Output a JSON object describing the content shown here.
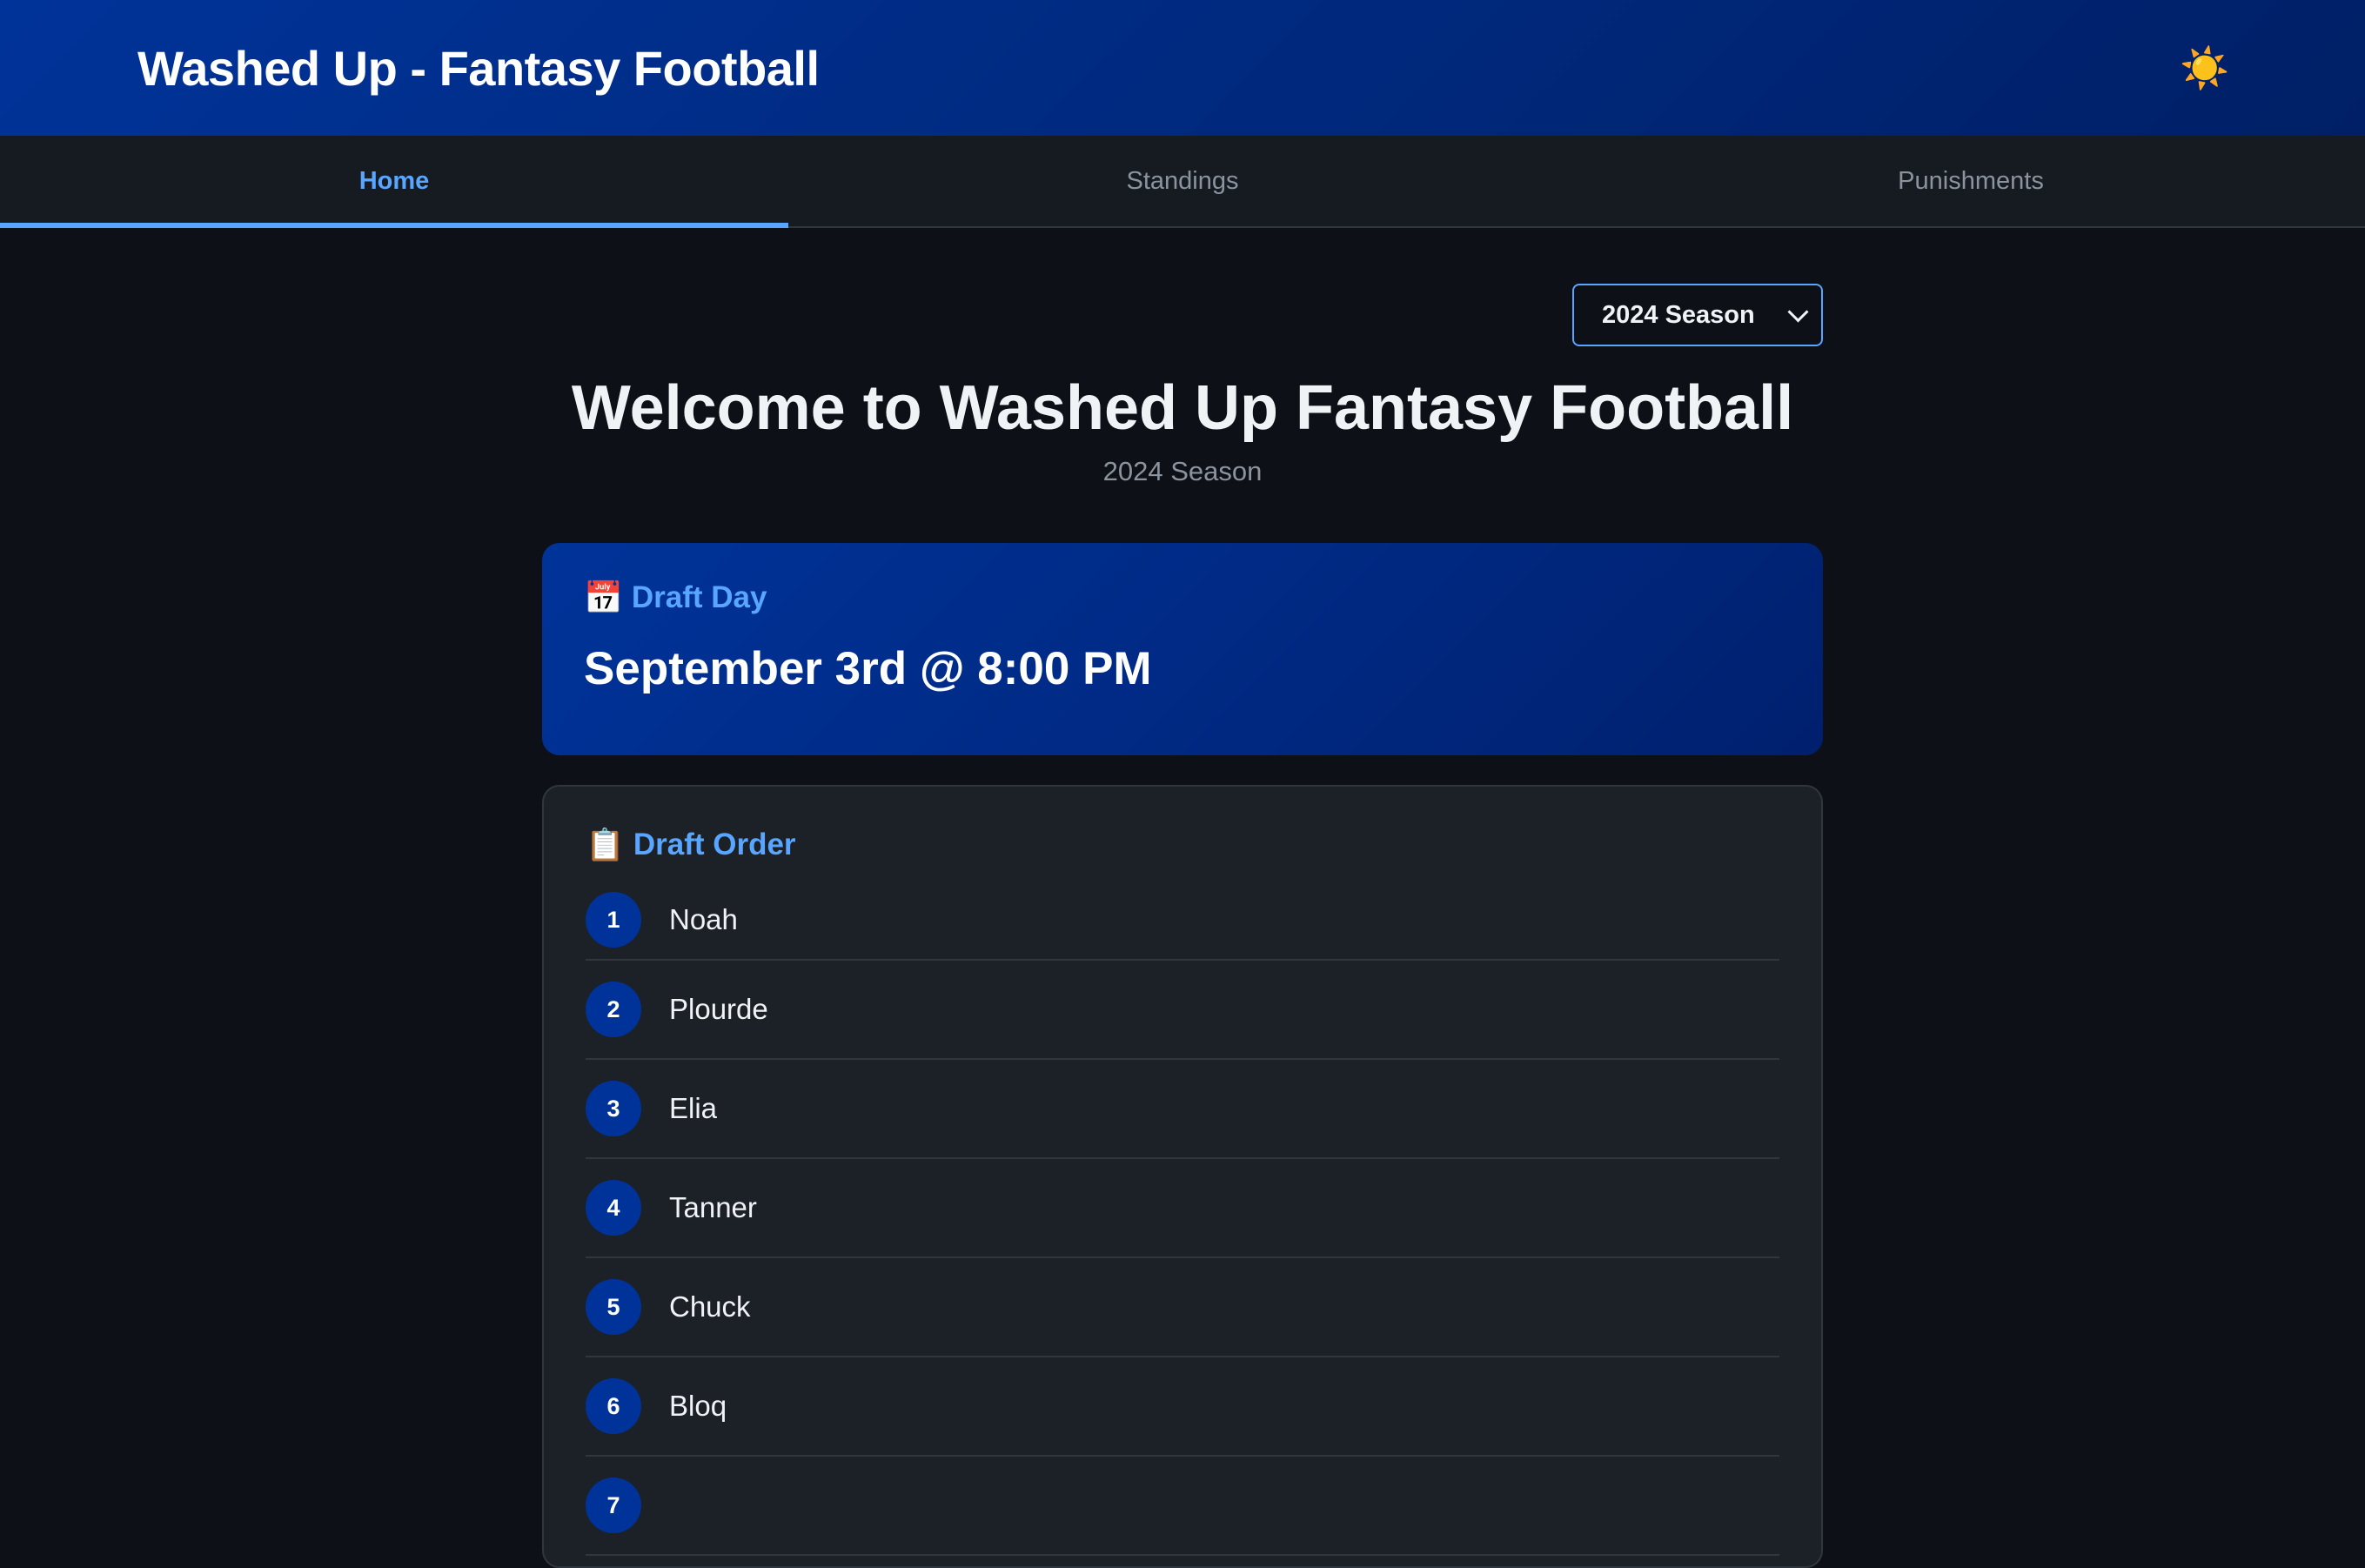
{
  "header": {
    "title": "Washed Up - Fantasy Football",
    "theme_icon": "sun-icon",
    "theme_glyph": "☀️"
  },
  "tabs": [
    {
      "label": "Home",
      "active": true
    },
    {
      "label": "Standings",
      "active": false
    },
    {
      "label": "Punishments",
      "active": false
    }
  ],
  "season_select": {
    "selected": "2024 Season"
  },
  "page": {
    "title": "Welcome to Washed Up Fantasy Football",
    "subtitle": "2024 Season"
  },
  "draft_day": {
    "icon": "calendar-icon",
    "icon_glyph": "📅",
    "heading": "Draft Day",
    "date": "September 3rd @ 8:00 PM"
  },
  "draft_order": {
    "icon": "clipboard-icon",
    "icon_glyph": "📋",
    "heading": "Draft Order",
    "entries": [
      {
        "rank": "1",
        "name": "Noah"
      },
      {
        "rank": "2",
        "name": "Plourde"
      },
      {
        "rank": "3",
        "name": "Elia"
      },
      {
        "rank": "4",
        "name": "Tanner"
      },
      {
        "rank": "5",
        "name": "Chuck"
      },
      {
        "rank": "6",
        "name": "Bloq"
      },
      {
        "rank": "7",
        "name": ""
      }
    ]
  },
  "colors": {
    "accent": "#58a6ff",
    "brand_blue": "#003399",
    "background": "#0d1117",
    "card": "#1c2027"
  }
}
